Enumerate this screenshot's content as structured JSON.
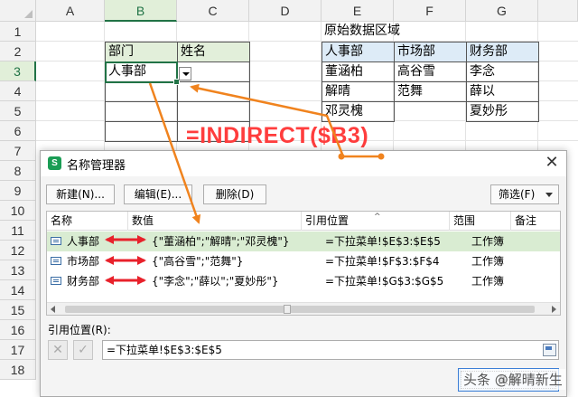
{
  "sheet": {
    "columns": [
      "A",
      "B",
      "C",
      "D",
      "E",
      "F",
      "G"
    ],
    "rows": [
      "1",
      "2",
      "3",
      "4",
      "5",
      "6",
      "7",
      "8",
      "9",
      "10",
      "11",
      "12",
      "13",
      "14",
      "15",
      "16",
      "17",
      "18"
    ],
    "headers": {
      "dept": "部门",
      "name": "姓名"
    },
    "b3_value": "人事部",
    "source_title": "原始数据区域",
    "source_headers": [
      "人事部",
      "市场部",
      "财务部"
    ],
    "source_col1": [
      "董涵柏",
      "解晴",
      "邓灵槐"
    ],
    "source_col2": [
      "高谷雪",
      "范舞"
    ],
    "source_col3": [
      "李念",
      "薛以",
      "夏妙彤"
    ],
    "formula_label": "=INDIRECT($B3)"
  },
  "dialog": {
    "title": "名称管理器",
    "buttons": {
      "new": "新建(N)...",
      "edit": "编辑(E)...",
      "delete": "删除(D)",
      "filter": "筛选(F)"
    },
    "columns": {
      "name": "名称",
      "value": "数值",
      "ref": "引用位置",
      "scope": "范围",
      "note": "备注"
    },
    "rows": [
      {
        "name": "人事部",
        "value": "{\"董涵柏\";\"解晴\";\"邓灵槐\"}",
        "ref": "=下拉菜单!$E$3:$E$5",
        "scope": "工作簿"
      },
      {
        "name": "市场部",
        "value": "{\"高谷雪\";\"范舞\"}",
        "ref": "=下拉菜单!$F$3:$F$4",
        "scope": "工作簿"
      },
      {
        "name": "财务部",
        "value": "{\"李念\";\"薛以\";\"夏妙彤\"}",
        "ref": "=下拉菜单!$G$3:$G$5",
        "scope": "工作簿"
      }
    ],
    "ref_label": "引用位置(R):",
    "ref_value": "=下拉菜单!$E$3:$E$5",
    "cancel_glyph": "✕",
    "confirm_glyph": "✓",
    "close_label": "关闭"
  },
  "watermark": "头条 @解晴新生",
  "colors": {
    "accent_green": "#217346",
    "header_green": "#e2efda",
    "header_blue": "#ddebf7",
    "annotation_orange": "#f0831e",
    "arrow_red": "#e8212b",
    "formula_red": "#ff3d3d"
  }
}
